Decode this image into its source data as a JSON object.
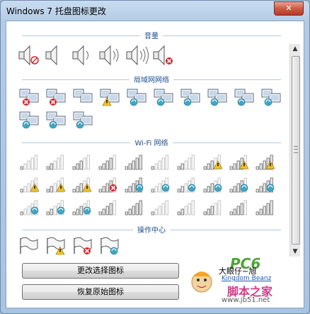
{
  "window": {
    "title": "Windows 7 托盘图标更改",
    "close_label": "✕"
  },
  "sections": {
    "volume": "音量",
    "lan": "局域网网络",
    "wifi": "Wi-Fi 网络",
    "action": "操作中心"
  },
  "buttons": {
    "change": "更改选择图标",
    "restore": "恢复原始图标"
  },
  "scrollbar": {
    "up": "▲",
    "down": "▼"
  },
  "watermark": {
    "site": "www.jb51.net",
    "brand_cn": "脚本之家",
    "brand_en": "Kingdom Beanz",
    "logo_text": "PC6",
    "char": "大眼仔~旭"
  },
  "colors": {
    "accent": "#1d4f91",
    "error_badge": "#d8262b",
    "warning_badge": "#f2c428",
    "ok_badge": "#3fa6c6"
  },
  "icons": {
    "volume": [
      "mute",
      "level0",
      "level1",
      "level2",
      "level3",
      "error"
    ],
    "lan": [
      "error",
      "error",
      "none",
      "warning",
      "busy",
      "busy",
      "busy",
      "busy",
      "busy",
      "busy",
      "busy",
      "busy",
      "busy"
    ],
    "wifi": [
      "s1",
      "s2",
      "s3",
      "s4",
      "s5",
      "s1",
      "s2",
      "s3-warn",
      "s4-warn",
      "s5-warn",
      "s1-warn",
      "s2-warn",
      "s3-alert",
      "s4-error",
      "s5-busy",
      "s1-busy",
      "s2-busy",
      "s3-busy",
      "s4-busy",
      "s5-busy",
      "s1-busy",
      "s2-busy",
      "s3-busy",
      "s4",
      "s5",
      "s1",
      "s2",
      "s3",
      "s4",
      "s5"
    ],
    "action": [
      "flag",
      "flag-warning",
      "flag-error",
      "flag-busy"
    ]
  }
}
